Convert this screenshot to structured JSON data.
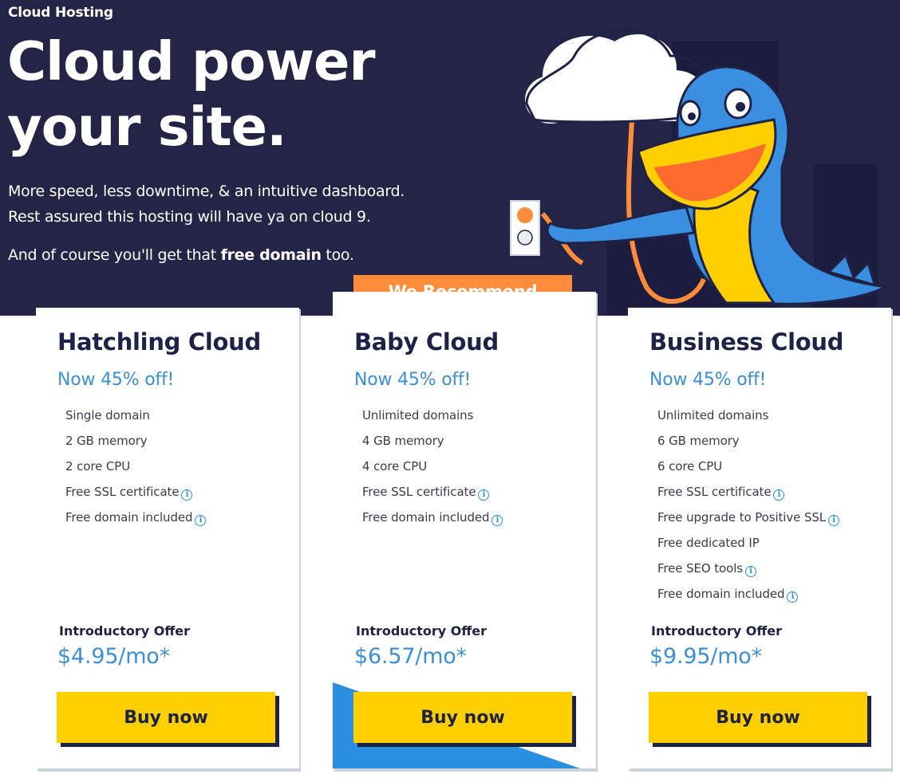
{
  "hero": {
    "eyebrow": "Cloud Hosting",
    "headline_line1": "Cloud power",
    "headline_line2": "your site.",
    "sub_line1": "More speed, less downtime, & an intuitive dashboard.",
    "sub_line2": "Rest assured this hosting will have ya on cloud 9.",
    "sub2_prefix": "And of course you'll get that ",
    "sub2_bold": "free domain",
    "sub2_suffix": " too."
  },
  "recommend_label": "We Recommend",
  "plans": [
    {
      "name": "Hatchling Cloud",
      "discount": "Now 45% off!",
      "features": [
        "Single domain",
        "2 GB memory",
        "2 core CPU",
        "Free SSL certificate",
        "Free domain included"
      ],
      "offer_label": "Introductory Offer",
      "price": "$4.95/mo*",
      "button": "Buy now"
    },
    {
      "name": "Baby Cloud",
      "discount": "Now 45% off!",
      "features": [
        "Unlimited domains",
        "4 GB memory",
        "4 core CPU",
        "Free SSL certificate",
        "Free domain included"
      ],
      "offer_label": "Introductory Offer",
      "price": "$6.57/mo*",
      "button": "Buy now"
    },
    {
      "name": "Business Cloud",
      "discount": "Now 45% off!",
      "features": [
        "Unlimited domains",
        "6 GB memory",
        "6 core CPU",
        "Free SSL certificate",
        "Free upgrade to Positive SSL",
        "Free dedicated IP",
        "Free SEO tools",
        "Free domain included"
      ],
      "offer_label": "Introductory Offer",
      "price": "$9.95/mo*",
      "button": "Buy now"
    }
  ],
  "colors": {
    "hero_bg": "#242447",
    "accent_blue": "#3b8fd6",
    "button_yellow": "#ffcf00",
    "recommend_orange": "#ff8c3b",
    "navy": "#1f2247"
  }
}
